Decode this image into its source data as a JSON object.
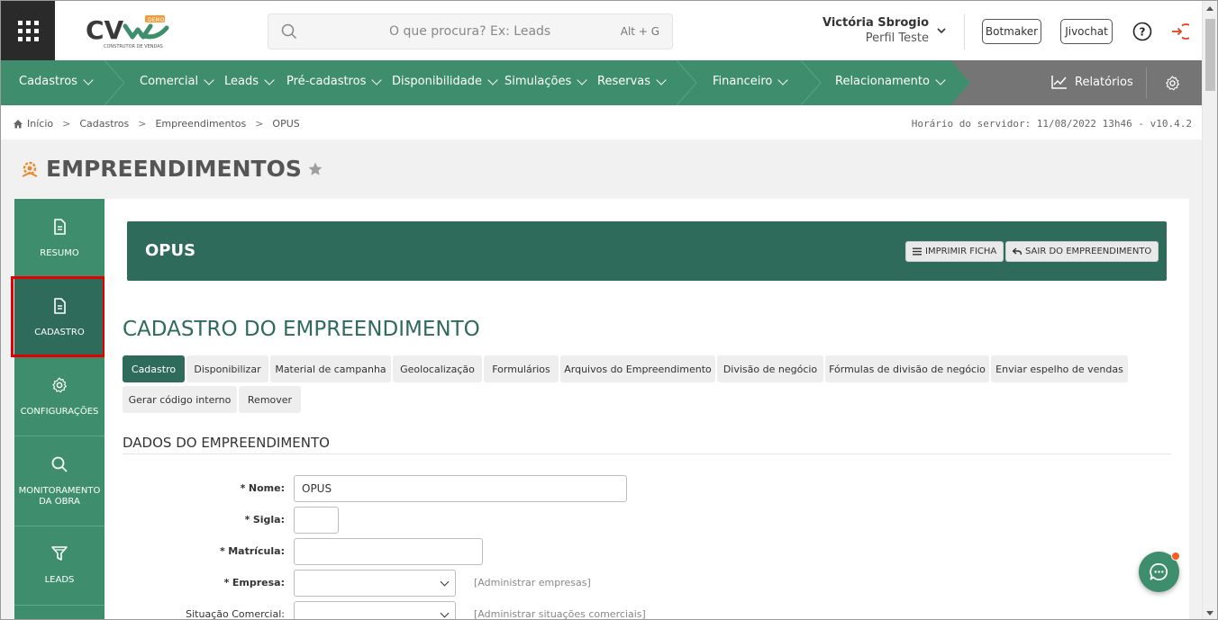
{
  "header": {
    "search_placeholder": "O que procura? Ex: Leads",
    "search_shortcut": "Alt + G",
    "user_name": "Victória Sbrogio",
    "user_profile": "Perfil Teste",
    "botmaker_label": "Botmaker",
    "jivochat_label": "Jivochat",
    "logo_text": "CV",
    "logo_badge": "DEMO",
    "logo_tagline": "CONSTRUTOR DE VENDAS"
  },
  "nav": {
    "items": [
      {
        "label": "Cadastros"
      },
      {
        "label": "Comercial"
      },
      {
        "label": "Leads"
      },
      {
        "label": "Pré-cadastros"
      },
      {
        "label": "Disponibilidade"
      },
      {
        "label": "Simulações"
      },
      {
        "label": "Reservas"
      },
      {
        "label": "Financeiro"
      },
      {
        "label": "Relacionamento"
      }
    ],
    "reports_label": "Relatórios"
  },
  "breadcrumb": {
    "items": [
      "Início",
      "Cadastros",
      "Empreendimentos",
      "OPUS"
    ],
    "server_time": "Horário do servidor: 11/08/2022 13h46 - v10.4.2"
  },
  "page": {
    "title": "EMPREENDIMENTOS"
  },
  "sidebar": {
    "items": [
      {
        "label": "RESUMO",
        "icon": "document-icon"
      },
      {
        "label": "CADASTRO",
        "icon": "document-icon"
      },
      {
        "label": "CONFIGURAÇÕES",
        "icon": "gear-icon"
      },
      {
        "label": "MONITORAMENTO DA OBRA",
        "icon": "search-icon"
      },
      {
        "label": "LEADS",
        "icon": "funnel-icon"
      }
    ]
  },
  "banner": {
    "title": "OPUS",
    "print_label": "IMPRIMIR FICHA",
    "exit_label": "SAIR DO EMPREENDIMENTO"
  },
  "section": {
    "title": "CADASTRO DO EMPREENDIMENTO",
    "tabs": [
      "Cadastro",
      "Disponibilizar",
      "Material de campanha",
      "Geolocalização",
      "Formulários",
      "Arquivos do Empreendimento",
      "Divisão de negócio",
      "Fórmulas de divisão de negócio",
      "Enviar espelho de vendas",
      "Gerar código interno",
      "Remover"
    ],
    "subtitle": "DADOS DO EMPREENDIMENTO"
  },
  "form": {
    "nome_label": "Nome:",
    "nome_value": "OPUS",
    "sigla_label": "Sigla:",
    "sigla_value": "",
    "matricula_label": "Matrícula:",
    "matricula_value": "",
    "empresa_label": "Empresa:",
    "empresa_value": "",
    "empresa_link": "[Administrar empresas]",
    "situacao_label": "Situação Comercial:",
    "situacao_value": "",
    "situacao_link": "[Administrar situações comerciais]",
    "required_mark": "*"
  },
  "colors": {
    "nav_green": "#3e8e6e",
    "dark_green": "#2f6b5a",
    "nav_gray": "#757575",
    "logout_red": "#e8431f",
    "highlight_red": "#e50000"
  }
}
